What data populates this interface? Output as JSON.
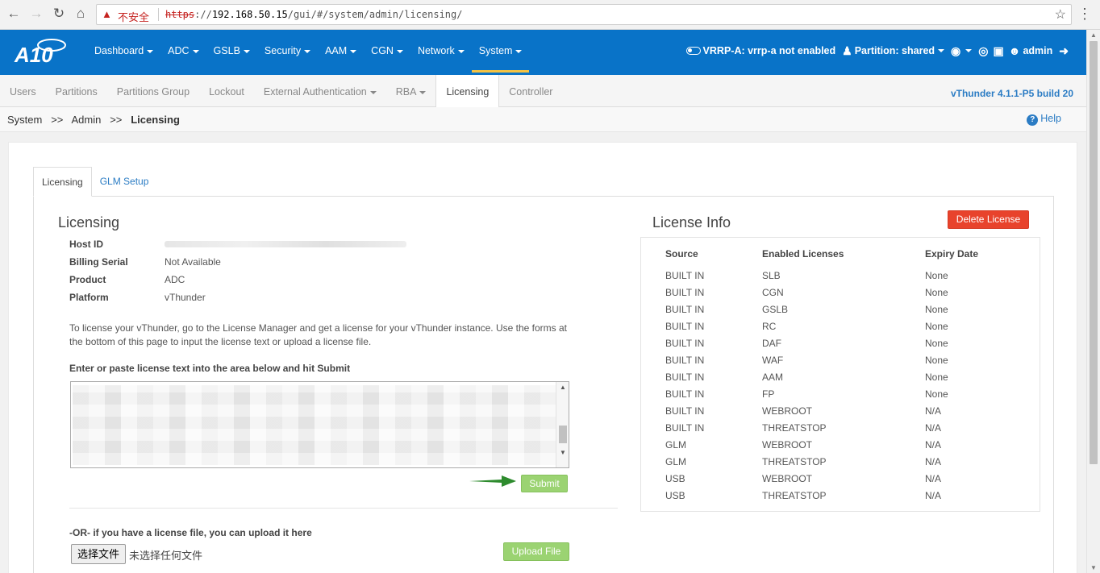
{
  "browser": {
    "insecure_label": "不安全",
    "url_scheme": "https",
    "url_sep": "://",
    "url_host": "192.168.50.15",
    "url_path": "/gui/#/system/admin/licensing/"
  },
  "header": {
    "nav": [
      {
        "label": "Dashboard"
      },
      {
        "label": "ADC"
      },
      {
        "label": "GSLB"
      },
      {
        "label": "Security"
      },
      {
        "label": "AAM"
      },
      {
        "label": "CGN"
      },
      {
        "label": "Network"
      },
      {
        "label": "System"
      }
    ],
    "vrrp": "VRRP-A: vrrp-a not enabled",
    "partition": "Partition: shared",
    "user": "admin"
  },
  "subnav": {
    "tabs": [
      {
        "label": "Users"
      },
      {
        "label": "Partitions"
      },
      {
        "label": "Partitions Group"
      },
      {
        "label": "Lockout"
      },
      {
        "label": "External Authentication"
      },
      {
        "label": "RBA"
      },
      {
        "label": "Licensing"
      },
      {
        "label": "Controller"
      }
    ],
    "version": "vThunder 4.1.1-P5 build 20"
  },
  "breadcrumb": {
    "part1": "System",
    "sep": ">>",
    "part2": "Admin",
    "current": "Licensing",
    "help": "Help"
  },
  "inner_tabs": [
    {
      "label": "Licensing"
    },
    {
      "label": "GLM Setup"
    }
  ],
  "licensing": {
    "title": "Licensing",
    "rows": [
      {
        "label": "Host ID",
        "value": ""
      },
      {
        "label": "Billing Serial",
        "value": "Not Available"
      },
      {
        "label": "Product",
        "value": "ADC"
      },
      {
        "label": "Platform",
        "value": "vThunder"
      }
    ],
    "instructions": "To license your vThunder, go to the License Manager and get a license for your vThunder instance. Use the forms at the bottom of this page to input the license text or upload a license file.",
    "paste_label": "Enter or paste license text into the area below and hit Submit",
    "submit": "Submit",
    "or_label": "-OR- if you have a license file, you can upload it here",
    "choose_file": "选择文件",
    "no_file": "未选择任何文件",
    "upload": "Upload File"
  },
  "license_info": {
    "title": "License Info",
    "delete": "Delete License",
    "columns": [
      "Source",
      "Enabled Licenses",
      "Expiry Date"
    ],
    "rows": [
      [
        "BUILT IN",
        "SLB",
        "None"
      ],
      [
        "BUILT IN",
        "CGN",
        "None"
      ],
      [
        "BUILT IN",
        "GSLB",
        "None"
      ],
      [
        "BUILT IN",
        "RC",
        "None"
      ],
      [
        "BUILT IN",
        "DAF",
        "None"
      ],
      [
        "BUILT IN",
        "WAF",
        "None"
      ],
      [
        "BUILT IN",
        "AAM",
        "None"
      ],
      [
        "BUILT IN",
        "FP",
        "None"
      ],
      [
        "BUILT IN",
        "WEBROOT",
        "N/A"
      ],
      [
        "BUILT IN",
        "THREATSTOP",
        "N/A"
      ],
      [
        "GLM",
        "WEBROOT",
        "N/A"
      ],
      [
        "GLM",
        "THREATSTOP",
        "N/A"
      ],
      [
        "USB",
        "WEBROOT",
        "N/A"
      ],
      [
        "USB",
        "THREATSTOP",
        "N/A"
      ]
    ]
  },
  "colors": {
    "header_blue": "#0973c8",
    "accent_green": "#9bd372",
    "danger_red": "#e8432c",
    "link_blue": "#2b7cc4"
  }
}
